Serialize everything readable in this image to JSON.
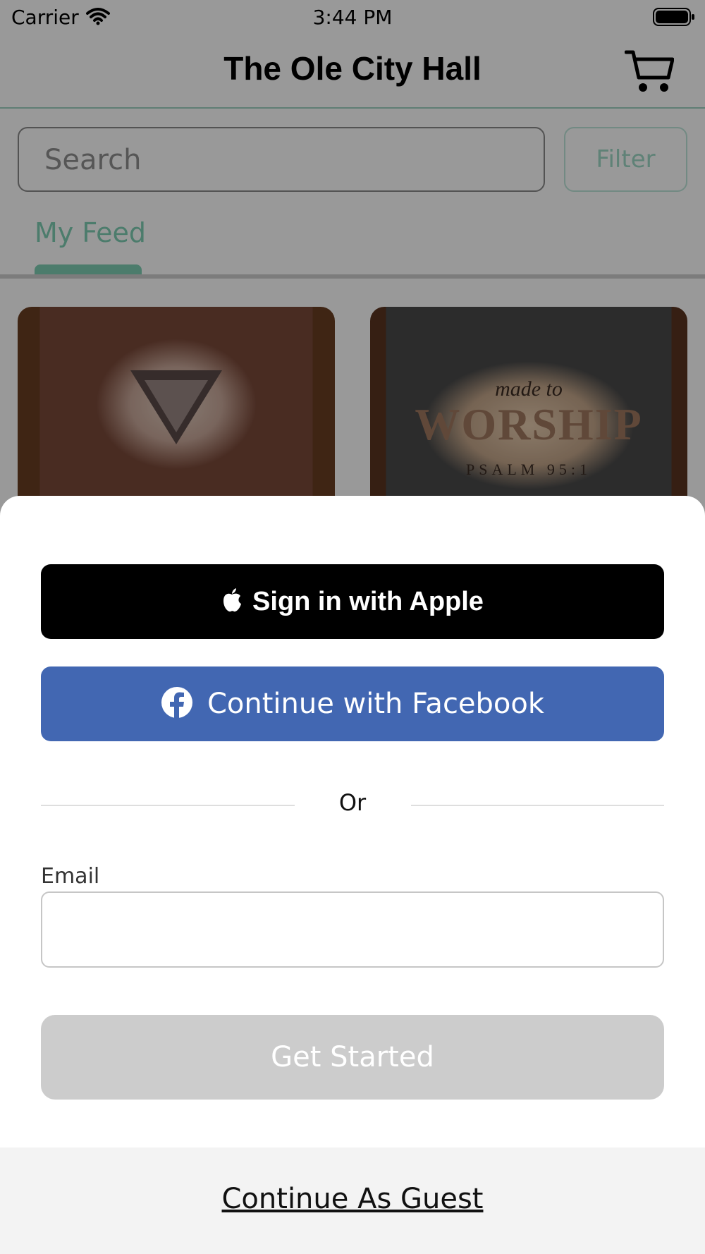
{
  "status_bar": {
    "carrier": "Carrier",
    "time": "3:44 PM"
  },
  "header": {
    "title": "The Ole City Hall"
  },
  "search": {
    "placeholder": "Search",
    "filter_label": "Filter"
  },
  "tabs": [
    {
      "label": "My Feed",
      "active": true
    }
  ],
  "products": [
    {
      "image": "bleached sweatshirt",
      "print": ""
    },
    {
      "image": "bleached t-shirt",
      "print": [
        "made to",
        "WORSHIP",
        "PSALM 95:1"
      ]
    }
  ],
  "login_sheet": {
    "apple_button": "Sign in with Apple",
    "facebook_button": "Continue with Facebook",
    "divider_text": "Or",
    "email_label": "Email",
    "email_value": "",
    "get_started_button": "Get Started",
    "guest_link": "Continue As Guest"
  },
  "colors": {
    "accent": "#7fcfb4",
    "facebook": "#4267b2",
    "apple": "#000000",
    "disabled_button": "#cccccc"
  }
}
